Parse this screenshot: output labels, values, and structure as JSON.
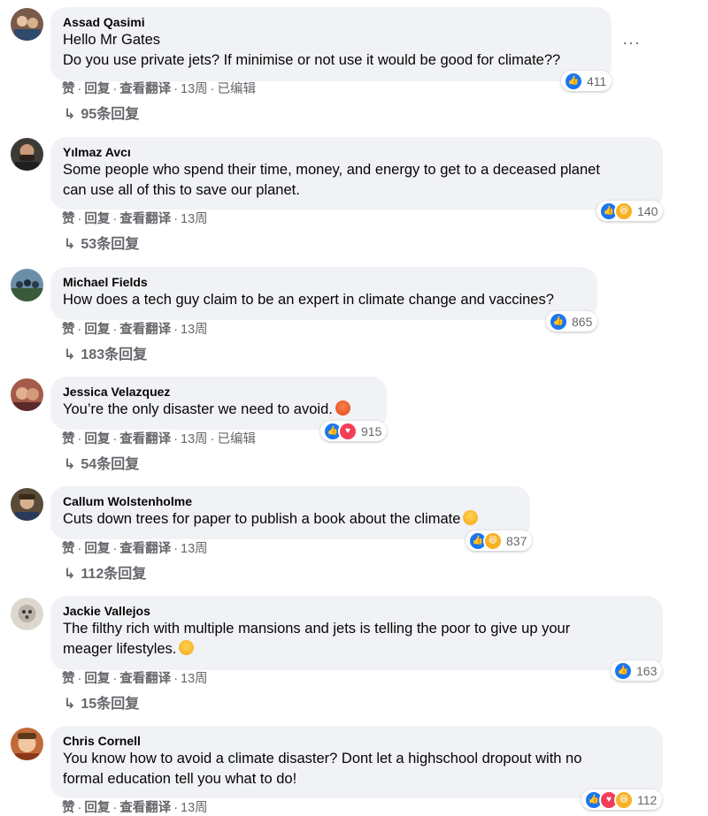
{
  "comments": [
    {
      "name": "Assad Qasimi",
      "text_lines": [
        "Hello Mr Gates",
        "Do you use private jets? If minimise or not use it would be good for climate??"
      ],
      "reactions": [
        "like"
      ],
      "reaction_count": "411",
      "actions": {
        "like": "赞",
        "reply": "回复",
        "translate": "查看翻译",
        "time": "13周",
        "edited": "已编辑"
      },
      "replies": "95条回复",
      "avatar_color": "#7a5a4a"
    },
    {
      "name": "Yılmaz Avcı",
      "text_lines": [
        "Some people who spend their time, money, and energy to get to a deceased planet",
        "can use all of this to save our planet."
      ],
      "reactions": [
        "like",
        "haha"
      ],
      "reaction_count": "140",
      "actions": {
        "like": "赞",
        "reply": "回复",
        "translate": "查看翻译",
        "time": "13周",
        "edited": ""
      },
      "replies": "53条回复",
      "avatar_color": "#3d3a36"
    },
    {
      "name": "Michael Fields",
      "text_lines": [
        "How does a tech guy claim to be an expert in climate change and vaccines?"
      ],
      "reactions": [
        "like"
      ],
      "reaction_count": "865",
      "actions": {
        "like": "赞",
        "reply": "回复",
        "translate": "查看翻译",
        "time": "13周",
        "edited": ""
      },
      "replies": "183条回复",
      "avatar_color": "#3f6b8a"
    },
    {
      "name": "Jessica Velazquez",
      "text_lines": [
        "You’re the only disaster we need to avoid."
      ],
      "text_emoji": "angry",
      "reactions": [
        "like",
        "love"
      ],
      "reaction_count": "915",
      "actions": {
        "like": "赞",
        "reply": "回复",
        "translate": "查看翻译",
        "time": "13周",
        "edited": "已编辑"
      },
      "replies": "54条回复",
      "avatar_color": "#a55a4a"
    },
    {
      "name": "Callum Wolstenholme",
      "text_lines": [
        "Cuts down trees for paper to publish a book about the climate"
      ],
      "text_emoji": "cry",
      "reactions": [
        "like",
        "haha"
      ],
      "reaction_count": "837",
      "actions": {
        "like": "赞",
        "reply": "回复",
        "translate": "查看翻译",
        "time": "13周",
        "edited": ""
      },
      "replies": "112条回复",
      "avatar_color": "#5a4a3a"
    },
    {
      "name": "Jackie Vallejos",
      "text_lines": [
        "The filthy rich with multiple mansions and jets is telling the poor to give up your",
        "meager lifestyles."
      ],
      "text_emoji": "cry",
      "reactions": [
        "like"
      ],
      "reaction_count": "163",
      "actions": {
        "like": "赞",
        "reply": "回复",
        "translate": "查看翻译",
        "time": "13周",
        "edited": ""
      },
      "replies": "15条回复",
      "avatar_color": "#b8b2a8"
    },
    {
      "name": "Chris Cornell",
      "text_lines": [
        "You know how to avoid a climate disaster? Dont let a highschool dropout with no",
        "formal education tell you what to do!"
      ],
      "reactions": [
        "like",
        "love",
        "haha"
      ],
      "reaction_count": "112",
      "actions": {
        "like": "赞",
        "reply": "回复",
        "translate": "查看翻译",
        "time": "13周",
        "edited": ""
      },
      "replies": "",
      "avatar_color": "#c26a3a"
    }
  ],
  "more_menu": "···"
}
